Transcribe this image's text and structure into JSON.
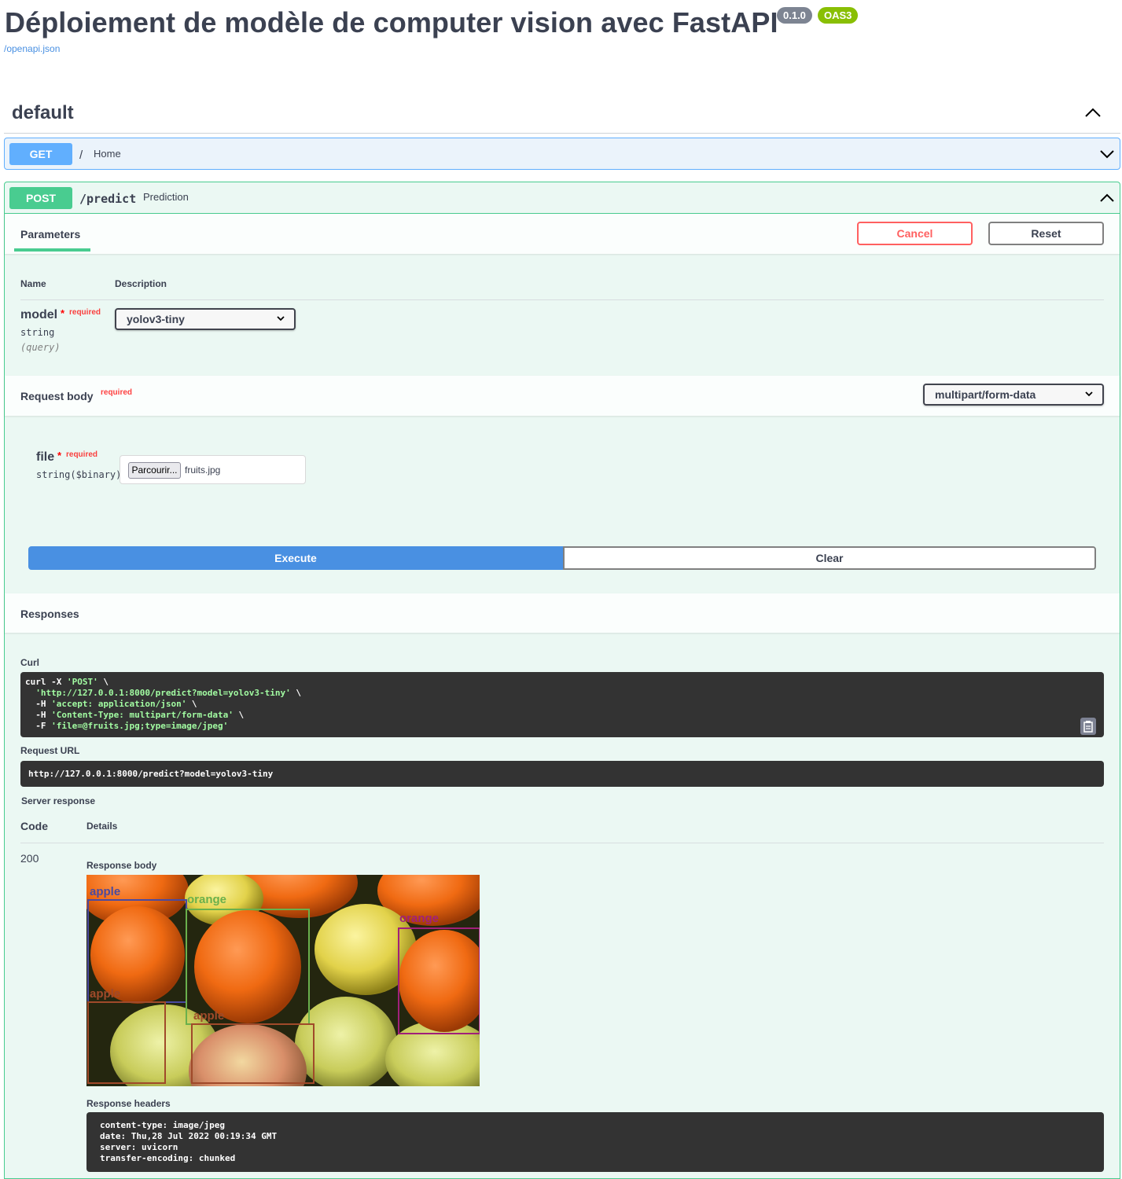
{
  "header": {
    "title": "Déploiement de modèle de computer vision avec FastAPI",
    "version": "0.1.0",
    "oas": "OAS3",
    "openapi_link": "/openapi.json"
  },
  "tag": {
    "name": "default",
    "chevron_icon": "chevron-up-icon"
  },
  "get_operation": {
    "method": "GET",
    "path": "/",
    "summary": "Home",
    "color": "#61affe"
  },
  "post_operation": {
    "method": "POST",
    "path": "/predict",
    "summary": "Prediction",
    "color": "#49cc90",
    "params_tab": "Parameters",
    "cancel_label": "Cancel",
    "reset_label": "Reset",
    "columns": {
      "name": "Name",
      "description": "Description"
    },
    "parameter": {
      "name": "model",
      "star": "*",
      "required": "required",
      "type": "string",
      "in": "(query)",
      "selected": "yolov3-tiny"
    },
    "request_body": {
      "label": "Request body",
      "required": "required",
      "content_type": "multipart/form-data",
      "file_label": "file",
      "file_star": "*",
      "file_required": "required",
      "file_type": "string($binary)",
      "browse_label": "Parcourir...",
      "file_name": "fruits.jpg"
    },
    "execute_label": "Execute",
    "clear_label": "Clear",
    "responses_label": "Responses",
    "curl_label": "Curl",
    "curl": {
      "l1_a": "curl -X ",
      "l1_b": "'POST'",
      "l1_c": " \\",
      "l2_b": "'http://127.0.0.1:8000/predict?model=yolov3-tiny'",
      "l2_c": " \\",
      "l3_a": "-H ",
      "l3_b": "'accept: application/json'",
      "l3_c": " \\",
      "l4_a": "-H ",
      "l4_b": "'Content-Type: multipart/form-data'",
      "l4_c": " \\",
      "l5_a": "-F ",
      "l5_b": "'file=@fruits.jpg;type=image/jpeg'"
    },
    "request_url_label": "Request URL",
    "request_url": "http://127.0.0.1:8000/predict?model=yolov3-tiny",
    "server_response_label": "Server response",
    "code_col": "Code",
    "details_col": "Details",
    "status_code": "200",
    "response_body_label": "Response body",
    "detections": [
      {
        "label": "apple",
        "color": "#4a4aa0"
      },
      {
        "label": "orange",
        "color": "#6ab04c"
      },
      {
        "label": "orange",
        "color": "#a0207a"
      },
      {
        "label": "apple",
        "color": "#a04a2a"
      },
      {
        "label": "apple",
        "color": "#a04a2a"
      }
    ],
    "response_headers_label": "Response headers",
    "headers": [
      "content-type: image/jpeg",
      "date: Thu,28 Jul 2022 00:19:34 GMT",
      "server: uvicorn",
      "transfer-encoding: chunked"
    ]
  }
}
